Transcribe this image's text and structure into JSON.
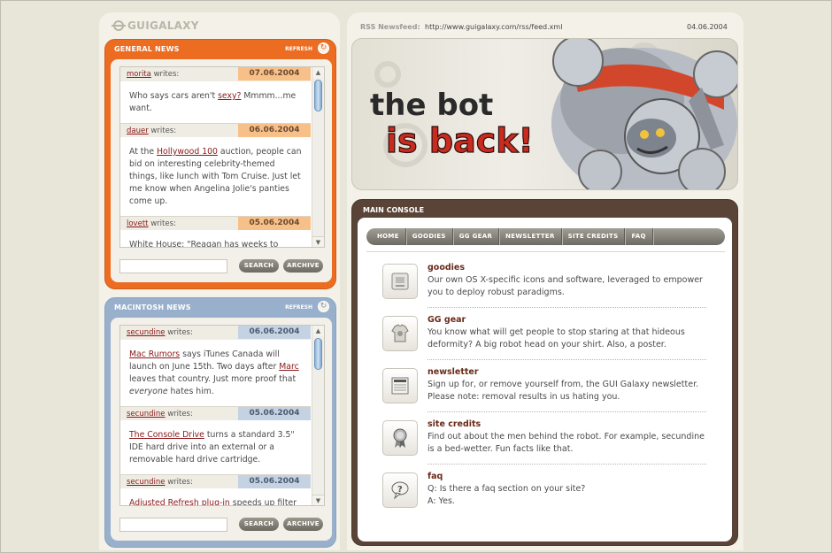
{
  "brand": {
    "logo_text": "GUIGALAXY"
  },
  "rss": {
    "label": "RSS Newsfeed:",
    "url": "http://www.guigalaxy.com/rss/feed.xml",
    "date": "04.06.2004"
  },
  "banner": {
    "line1": "the bot",
    "line2": "is back!"
  },
  "general_news": {
    "title": "GENERAL NEWS",
    "refresh_label": "REFRESH",
    "search_button": "SEARCH",
    "archive_button": "ARCHIVE",
    "search_value": "",
    "writes_label": "writes:",
    "items": [
      {
        "author": "morita",
        "date": "07.06.2004",
        "pre": "Who says cars aren't ",
        "link": "sexy?",
        "post": " Mmmm...me want."
      },
      {
        "author": "dauer",
        "date": "06.06.2004",
        "pre": "At the ",
        "link": "Hollywood 100",
        "post": " auction, people can bid on interesting celebrity-themed things, like lunch with Tom Cruise. Just let me know when Angelina Jolie's panties come up."
      },
      {
        "author": "lovett",
        "date": "05.06.2004",
        "pre": "White House: \"Reagan has weeks to",
        "link": "",
        "post": ""
      }
    ]
  },
  "mac_news": {
    "title": "MACINTOSH NEWS",
    "refresh_label": "REFRESH",
    "search_button": "SEARCH",
    "archive_button": "ARCHIVE",
    "search_value": "",
    "writes_label": "writes:",
    "items": [
      {
        "author": "secundine",
        "date": "06.06.2004",
        "link1": "Mac Rumors",
        "t1": " says iTunes Canada will launch on June 15th. Two days after ",
        "link2": "Marc",
        "t2": " leaves that country. Just more proof that ",
        "em": "everyone",
        "t3": " hates him."
      },
      {
        "author": "secundine",
        "date": "05.06.2004",
        "link1": "The Console Drive",
        "t1": " turns a standard 3.5\" IDE hard drive into an external or a removable hard drive cartridge."
      },
      {
        "author": "secundine",
        "date": "05.06.2004",
        "link1": "Adjusted Refresh plug-in",
        "t1": " speeds up filter"
      }
    ]
  },
  "console": {
    "title": "MAIN CONSOLE",
    "tabs": [
      "HOME",
      "GOODIES",
      "GG GEAR",
      "NEWSLETTER",
      "SITE CREDITS",
      "FAQ"
    ],
    "items": [
      {
        "title": "goodies",
        "desc": "Our own OS X-specific icons and software, leveraged to empower you to deploy robust paradigms.",
        "icon": "software-box-icon"
      },
      {
        "title": "GG gear",
        "desc": "You know what will get people to stop staring at that hideous deformity? A big robot head on your shirt. Also, a poster.",
        "icon": "tshirt-icon"
      },
      {
        "title": "newsletter",
        "desc": "Sign up for, or remove yourself from, the GUI Galaxy newsletter. Please note: removal results in us hating you.",
        "icon": "newspaper-icon"
      },
      {
        "title": "site credits",
        "desc": "Find out about the men behind the robot. For example, secundine is a bed-wetter. Fun facts like that.",
        "icon": "ribbon-award-icon"
      },
      {
        "title": "faq",
        "desc": "Q: Is there a faq section on your site?\nA: Yes.",
        "icon": "speech-bubble-question-icon"
      }
    ]
  },
  "colors": {
    "orange": "#ec6c22",
    "blue": "#98b0cc",
    "brown": "#5a4438",
    "link": "#8a1a1a"
  }
}
